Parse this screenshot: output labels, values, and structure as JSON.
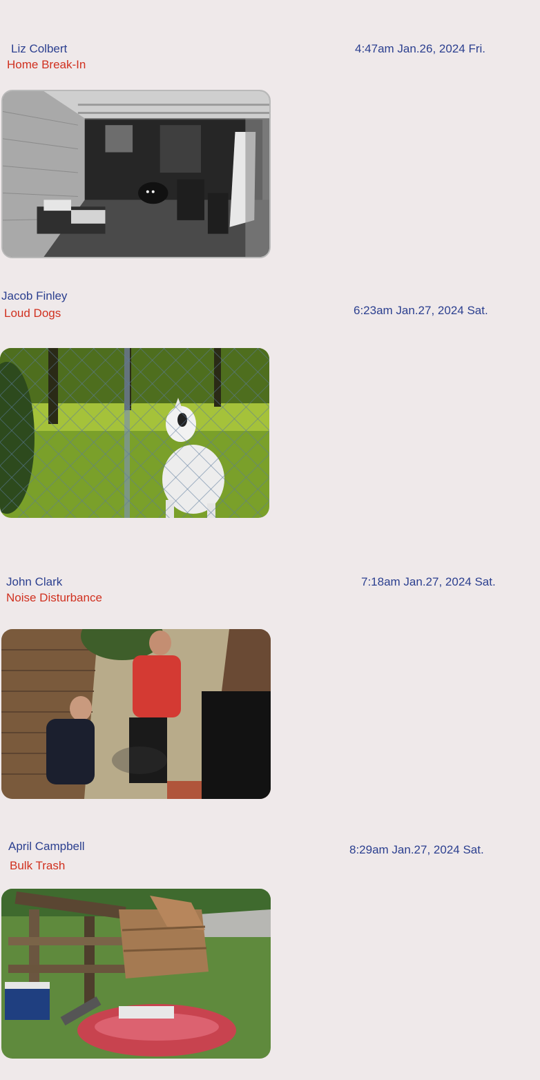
{
  "reports": [
    {
      "reporter": "Liz Colbert",
      "category": "Home Break-In",
      "timestamp": "4:47am Jan.26, 2024 Fri.",
      "image": "security-camera-porch-night"
    },
    {
      "reporter": "Jacob Finley",
      "category": "Loud Dogs",
      "timestamp": "6:23am Jan.27, 2024 Sat.",
      "image": "barking-dog-behind-fence"
    },
    {
      "reporter": "John Clark",
      "category": "Noise Disturbance",
      "timestamp": "7:18am Jan.27, 2024 Sat.",
      "image": "two-men-in-alley"
    },
    {
      "reporter": "April Campbell",
      "category": "Bulk Trash",
      "timestamp": "8:29am Jan.27, 2024 Sat.",
      "image": "bulk-trash-pile-curbside"
    }
  ],
  "colors": {
    "background": "#efe9ea",
    "name_text": "#2b3f8f",
    "category_text": "#d0301f"
  }
}
